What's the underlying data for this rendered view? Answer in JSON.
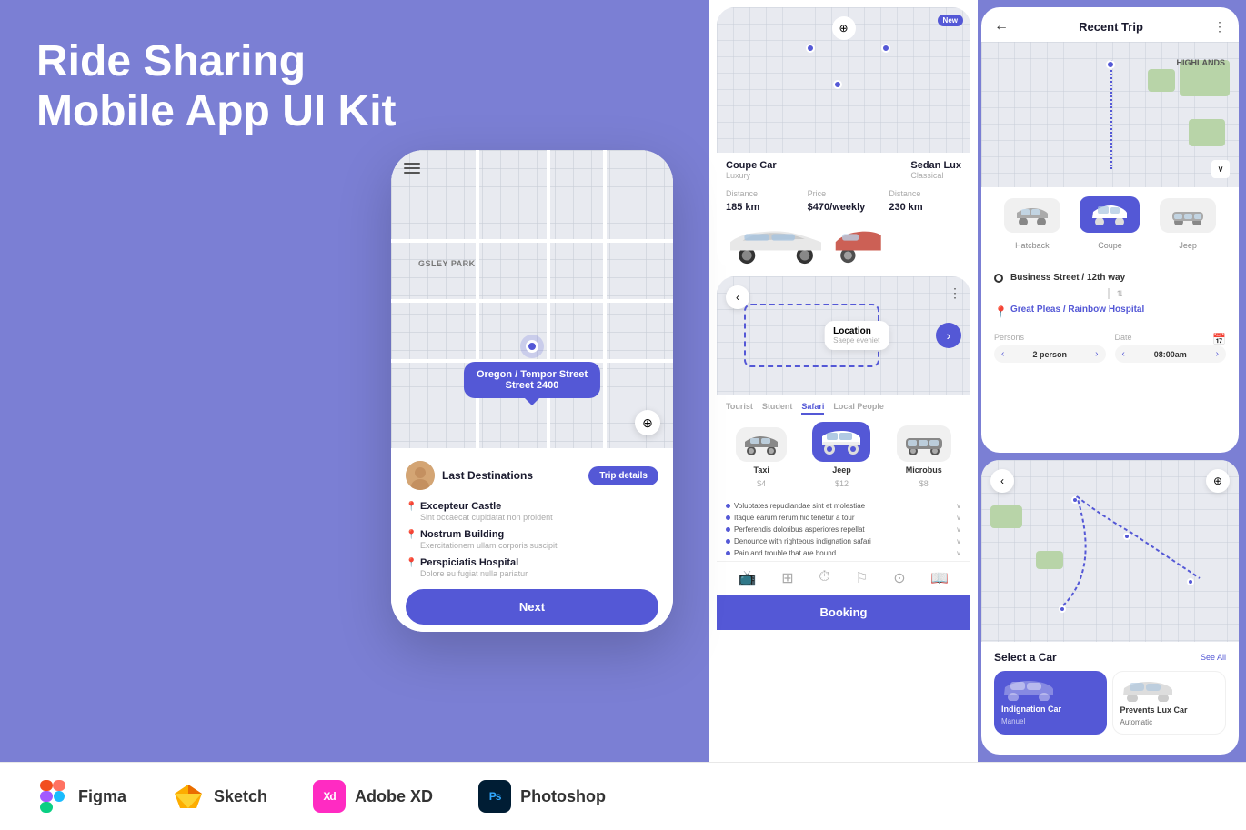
{
  "title": {
    "line1": "Ride Sharing",
    "line2": "Mobile App UI Kit"
  },
  "phone": {
    "map_label": "GSLEY PARK",
    "tooltip_line1": "Oregon / Tempor Street",
    "tooltip_line2": "Street 2400",
    "last_destinations": "Last Destinations",
    "trip_details_btn": "Trip details",
    "destinations": [
      {
        "name": "Excepteur Castle",
        "sub": "Sint occaecat cupidatat non proident"
      },
      {
        "name": "Nostrum Building",
        "sub": "Exercitationem ullam corporis suscipit"
      },
      {
        "name": "Perspiciatis Hospital",
        "sub": "Dolore eu fugiat nulla pariatur"
      }
    ],
    "next_btn": "Next"
  },
  "car_card": {
    "new_badge": "New",
    "car1_name": "Coupe Car",
    "car1_type": "Luxury",
    "car2_name": "Sedan Lux",
    "car2_type": "Classical",
    "distance_label": "Distance",
    "distance_value": "185 km",
    "price_label": "Price",
    "price_value": "$470/weekly",
    "distance2_label": "Distance",
    "distance2_value": "230 km"
  },
  "location_card": {
    "location_name": "Location",
    "location_sub": "Saepe eveniet",
    "trip_types": [
      "Tourist",
      "Student",
      "Safari",
      "Local People"
    ],
    "active_trip": "Safari",
    "vehicles": [
      {
        "name": "Taxi",
        "price": "$4"
      },
      {
        "name": "Jeep",
        "price": "$12",
        "selected": true
      },
      {
        "name": "Microbus",
        "price": "$8"
      }
    ],
    "features": [
      "Voluptates repudiandae sint et molestiae",
      "Itaque earum rerum hic tenetur a tour",
      "Perferendis doloribus asperiores repellat",
      "Denounce with righteous indignation safari",
      "Pain and trouble that are bound"
    ],
    "booking_btn": "Booking"
  },
  "recent_trip": {
    "title": "Recent Trip",
    "car_types": [
      "Hatcback",
      "Coupe",
      "Jeep"
    ],
    "active_car": "Coupe",
    "route_from": "Business Street / 12th way",
    "route_to": "Great Pleas / Rainbow Hospital",
    "persons_label": "Persons",
    "persons_value": "2 person",
    "date_label": "Date",
    "date_value": "08:00am"
  },
  "select_car": {
    "title": "Select a Car",
    "see_all": "See All",
    "cars": [
      {
        "name": "Indignation Car",
        "sub": "Manuel",
        "selected": true
      },
      {
        "name": "Prevents Lux Car",
        "sub": "Automatic",
        "selected": false
      }
    ]
  },
  "tools": [
    {
      "name": "Figma",
      "icon": "figma"
    },
    {
      "name": "Sketch",
      "icon": "sketch"
    },
    {
      "name": "Adobe XD",
      "icon": "xd"
    },
    {
      "name": "Photoshop",
      "icon": "ps"
    }
  ],
  "colors": {
    "accent": "#5458d6",
    "bg": "#7b7fd4",
    "white": "#ffffff",
    "text_dark": "#1a1a2e",
    "text_muted": "#aaaaaa"
  }
}
